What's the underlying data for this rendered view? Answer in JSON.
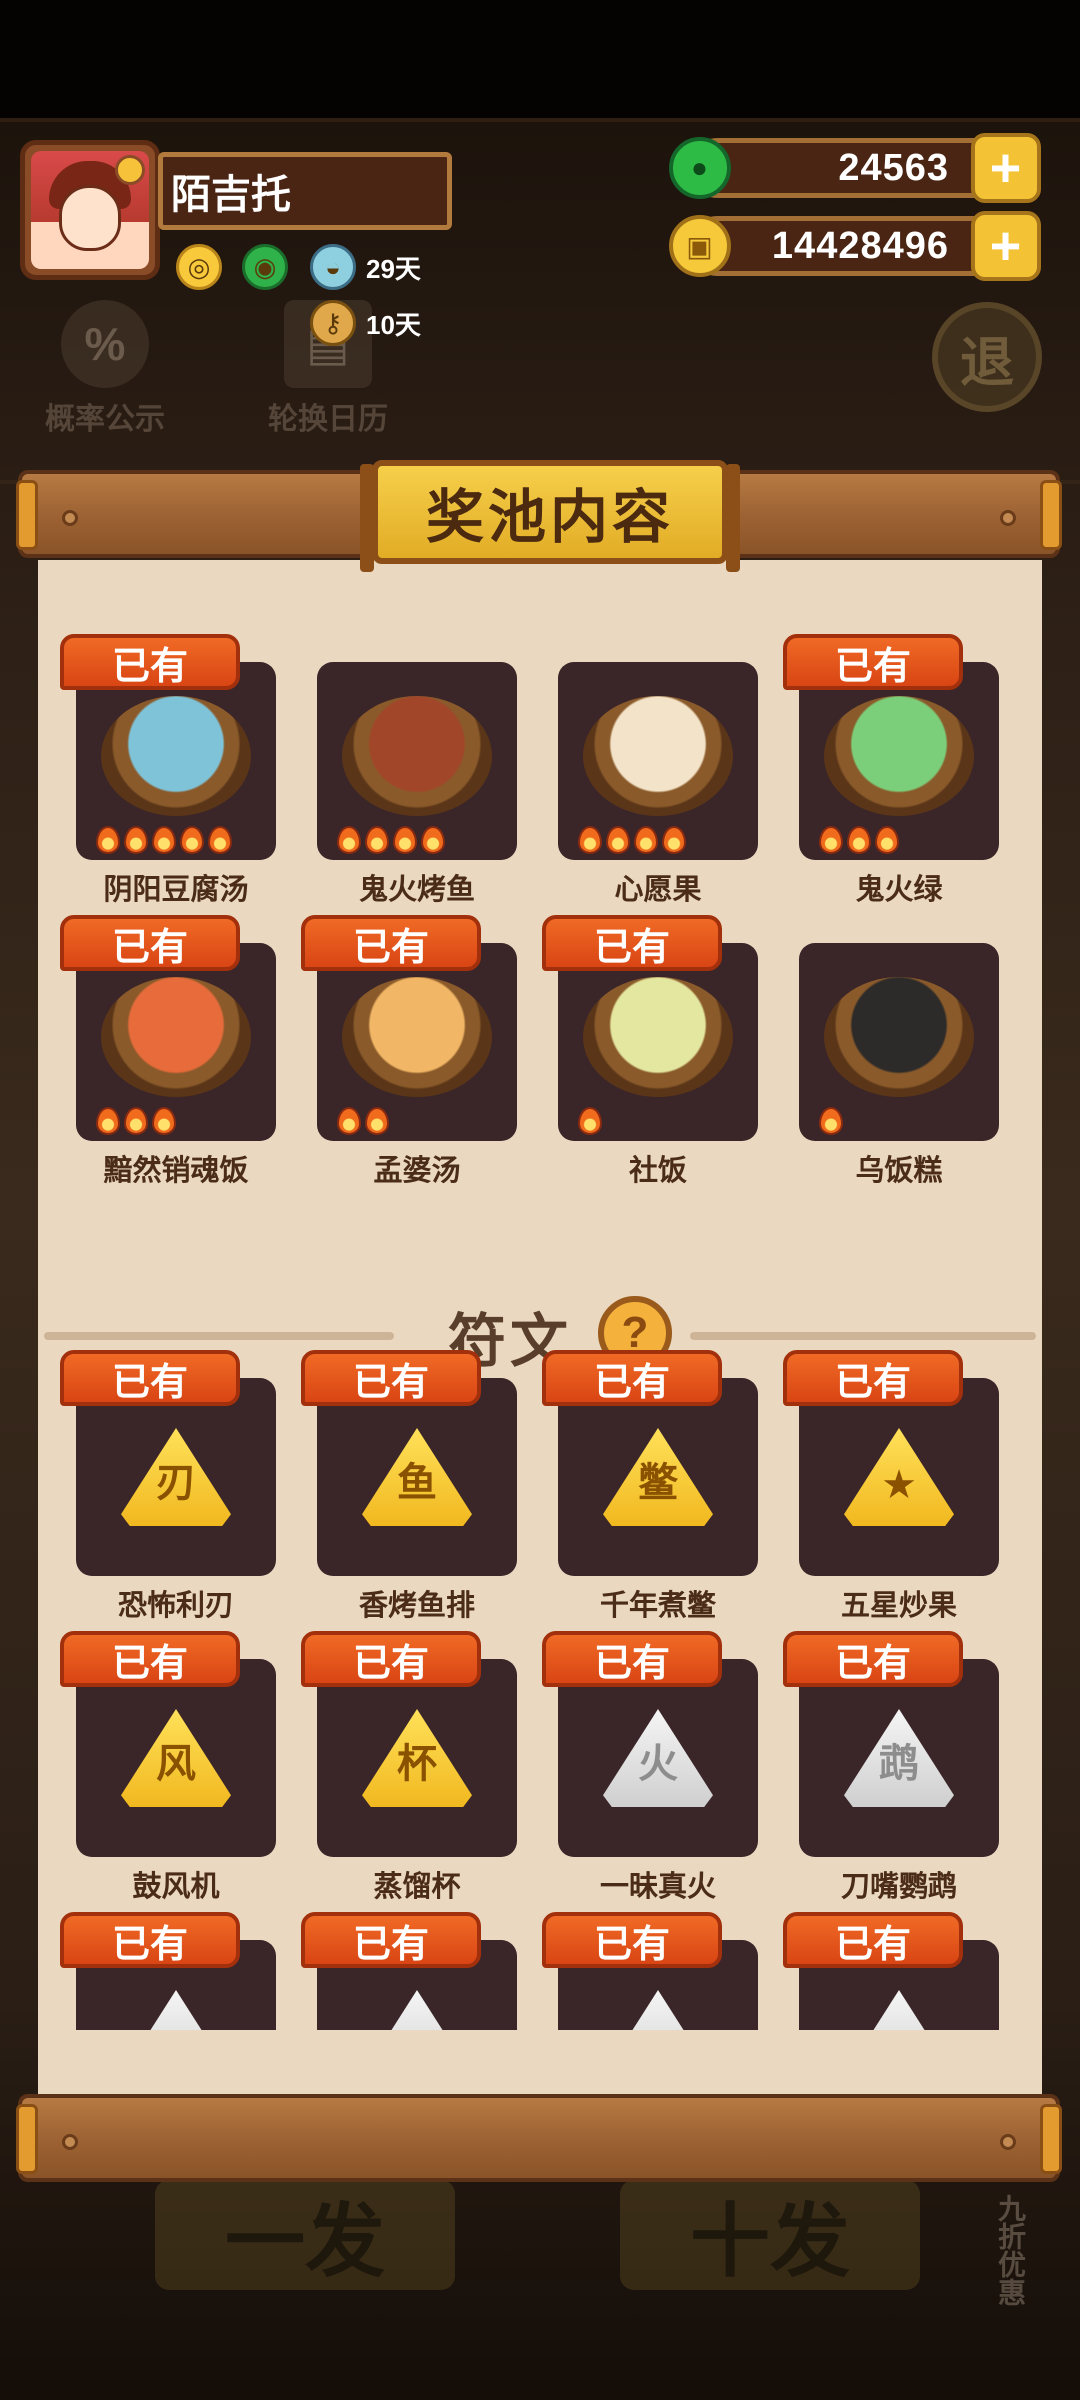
{
  "player": {
    "name": "陌吉托",
    "buff_pot_duration": "29天",
    "buff_key_duration": "10天"
  },
  "currency": {
    "jade": "24563",
    "coins": "14428496",
    "plus": "+"
  },
  "background": {
    "probability_label": "概率公示",
    "calendar_label": "轮换日历",
    "exit_label": "退",
    "single_draw": "一发",
    "ten_draw": "十发",
    "discount": "九折优惠"
  },
  "panel": {
    "title": "奖池内容",
    "owned_badge": "已有",
    "dishes_section": [
      {
        "name": "阴阳豆腐汤",
        "owned": true,
        "flames": 5,
        "color": "#7fc3d8"
      },
      {
        "name": "鬼火烤鱼",
        "owned": false,
        "flames": 4,
        "color": "#a2462a"
      },
      {
        "name": "心愿果",
        "owned": false,
        "flames": 4,
        "color": "#f3e3c8"
      },
      {
        "name": "鬼火绿",
        "owned": true,
        "flames": 3,
        "color": "#7ccf7a"
      },
      {
        "name": "黯然销魂饭",
        "owned": true,
        "flames": 3,
        "color": "#e86b3b"
      },
      {
        "name": "孟婆汤",
        "owned": true,
        "flames": 2,
        "color": "#f2b766"
      },
      {
        "name": "社饭",
        "owned": true,
        "flames": 1,
        "color": "#e4e7a0"
      },
      {
        "name": "乌饭糕",
        "owned": false,
        "flames": 1,
        "color": "#2d2b2a"
      }
    ],
    "rune_section_title": "符文",
    "help": "?",
    "runes": [
      {
        "name": "恐怖利刃",
        "owned": true,
        "tier": "gold",
        "glyph": "刃"
      },
      {
        "name": "香烤鱼排",
        "owned": true,
        "tier": "gold",
        "glyph": "鱼"
      },
      {
        "name": "千年煮鳖",
        "owned": true,
        "tier": "gold",
        "glyph": "鳖"
      },
      {
        "name": "五星炒果",
        "owned": true,
        "tier": "gold",
        "glyph": "★"
      },
      {
        "name": "鼓风机",
        "owned": true,
        "tier": "gold",
        "glyph": "风"
      },
      {
        "name": "蒸馏杯",
        "owned": true,
        "tier": "gold",
        "glyph": "杯"
      },
      {
        "name": "一昧真火",
        "owned": true,
        "tier": "silver",
        "glyph": "火"
      },
      {
        "name": "刀嘴鹦鹉",
        "owned": true,
        "tier": "silver",
        "glyph": "鹉"
      },
      {
        "name": "",
        "owned": true,
        "tier": "silver",
        "glyph": ""
      },
      {
        "name": "",
        "owned": true,
        "tier": "silver",
        "glyph": ""
      },
      {
        "name": "",
        "owned": true,
        "tier": "silver",
        "glyph": ""
      },
      {
        "name": "",
        "owned": true,
        "tier": "silver",
        "glyph": ""
      }
    ]
  }
}
